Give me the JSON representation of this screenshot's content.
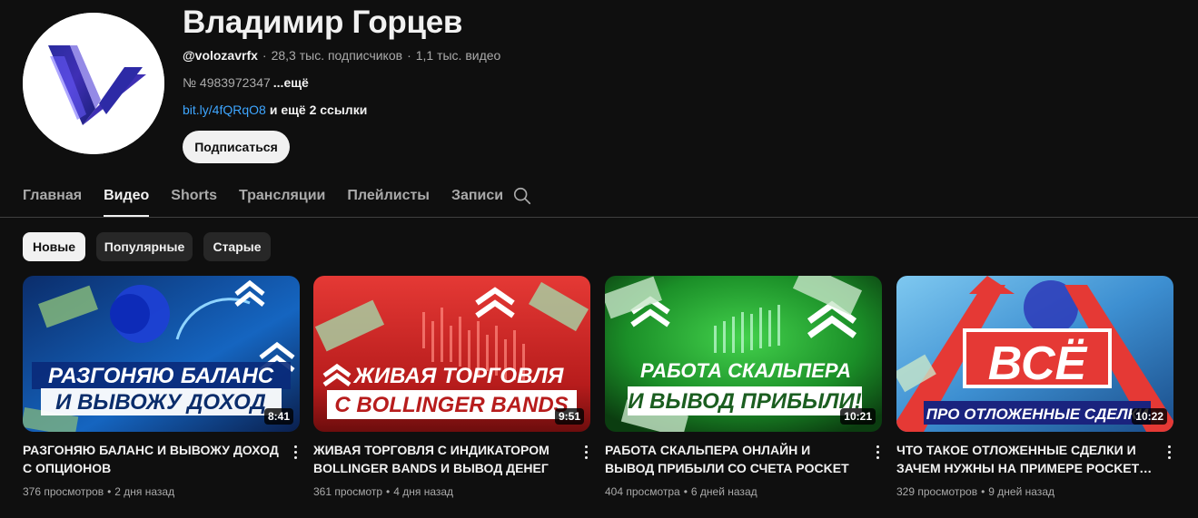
{
  "channel": {
    "name": "Владимир Горцев",
    "handle": "@volozavrfx",
    "subscribers": "28,3 тыс. подписчиков",
    "videos_count": "1,1 тыс. видео",
    "description": "№ 4983972347",
    "more_label": "...ещё",
    "link": "bit.ly/4fQRqO8",
    "extra_links": "и ещё 2 ссылки",
    "subscribe_label": "Подписаться"
  },
  "tabs": [
    {
      "label": "Главная",
      "active": false
    },
    {
      "label": "Видео",
      "active": true
    },
    {
      "label": "Shorts",
      "active": false
    },
    {
      "label": "Трансляции",
      "active": false
    },
    {
      "label": "Плейлисты",
      "active": false
    },
    {
      "label": "Записи",
      "active": false
    }
  ],
  "chips": [
    {
      "label": "Новые",
      "selected": true
    },
    {
      "label": "Популярные",
      "selected": false
    },
    {
      "label": "Старые",
      "selected": false
    }
  ],
  "videos": [
    {
      "title": "РАЗГОНЯЮ БАЛАНС И ВЫВОЖУ ДОХОД С ОПЦИОНОВ",
      "duration": "8:41",
      "views": "376 просмотров",
      "age": "2 дня назад",
      "thumb_text_1": "РАЗГОНЯЮ БАЛАНС",
      "thumb_text_2": "И ВЫВОЖУ ДОХОД",
      "thumb_color": "#1565c0"
    },
    {
      "title": "ЖИВАЯ ТОРГОВЛЯ С ИНДИКАТОРОМ BOLLINGER BANDS И ВЫВОД ДЕНЕГ",
      "duration": "9:51",
      "views": "361 просмотр",
      "age": "4 дня назад",
      "thumb_text_1": "ЖИВАЯ ТОРГОВЛЯ",
      "thumb_text_2": "С BOLLINGER BANDS",
      "thumb_color": "#c62828"
    },
    {
      "title": "РАБОТА СКАЛЬПЕРА ОНЛАЙН И ВЫВОД ПРИБЫЛИ СО СЧЕТА POCKET OPTION",
      "duration": "10:21",
      "views": "404 просмотра",
      "age": "6 дней назад",
      "thumb_text_1": "РАБОТА СКАЛЬПЕРА",
      "thumb_text_2": "И ВЫВОД ПРИБЫЛИ!",
      "thumb_color": "#2e7d32"
    },
    {
      "title": "ЧТО ТАКОЕ ОТЛОЖЕННЫЕ СДЕЛКИ И ЗАЧЕМ НУЖНЫ НА ПРИМЕРЕ POCKET…",
      "duration": "10:22",
      "views": "329 просмотров",
      "age": "9 дней назад",
      "thumb_text_1": "ВСЁ",
      "thumb_text_2": "ПРО ОТЛОЖЕННЫЕ СДЕЛКИ",
      "thumb_color": "#e53935"
    }
  ],
  "icons": {
    "search": "search-icon",
    "more": "more-vert-icon"
  }
}
